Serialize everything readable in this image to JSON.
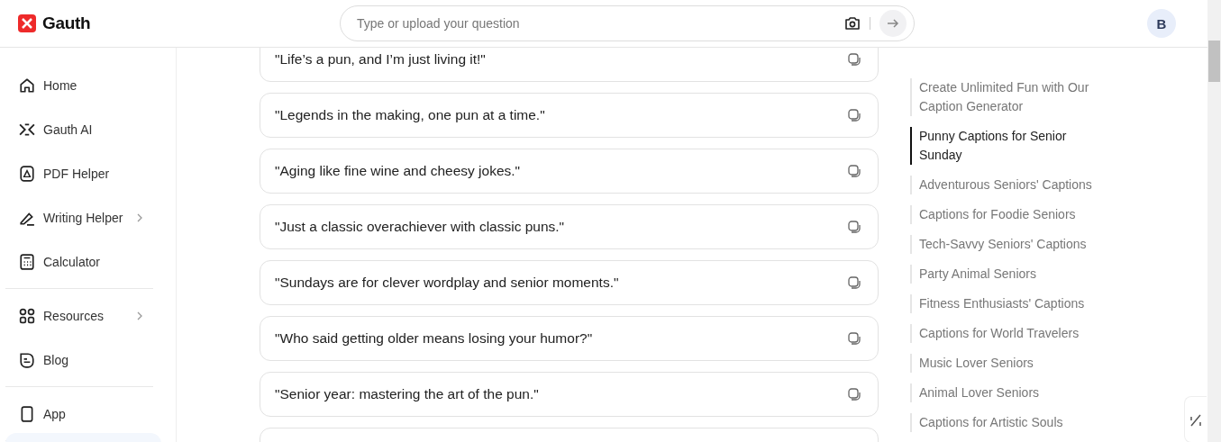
{
  "header": {
    "logo": "Gauth",
    "search": {
      "placeholder": "Type or upload your question"
    },
    "avatar": "B"
  },
  "sidebar": {
    "groups": [
      {
        "items": [
          {
            "label": "Home",
            "expandable": false
          },
          {
            "label": "Gauth AI",
            "expandable": false
          },
          {
            "label": "PDF Helper",
            "expandable": false
          },
          {
            "label": "Writing Helper",
            "expandable": true
          },
          {
            "label": "Calculator",
            "expandable": false
          }
        ]
      },
      {
        "items": [
          {
            "label": "Resources",
            "expandable": true
          },
          {
            "label": "Blog",
            "expandable": false
          }
        ]
      },
      {
        "items": [
          {
            "label": "App",
            "expandable": false
          }
        ]
      }
    ]
  },
  "captions": [
    "\"Life’s a pun, and I’m just living it!\"",
    "\"Legends in the making, one pun at a time.\"",
    "\"Aging like fine wine and cheesy jokes.\"",
    "\"Just a classic overachiever with classic puns.\"",
    "\"Sundays are for clever wordplay and senior moments.\"",
    "\"Who said getting older means losing your humor?\"",
    "\"Senior year: mastering the art of the pun.\""
  ],
  "toc": [
    {
      "label": "Create Unlimited Fun with Our Caption Generator",
      "selected": false
    },
    {
      "label": "Punny Captions for Senior Sunday",
      "selected": true
    },
    {
      "label": "Adventurous Seniors' Captions",
      "selected": false
    },
    {
      "label": "Captions for Foodie Seniors",
      "selected": false
    },
    {
      "label": "Tech-Savvy Seniors' Captions",
      "selected": false
    },
    {
      "label": "Party Animal Seniors",
      "selected": false
    },
    {
      "label": "Fitness Enthusiasts' Captions",
      "selected": false
    },
    {
      "label": "Captions for World Travelers",
      "selected": false
    },
    {
      "label": "Music Lover Seniors",
      "selected": false
    },
    {
      "label": "Animal Lover Seniors",
      "selected": false
    },
    {
      "label": "Captions for Artistic Souls",
      "selected": false
    }
  ]
}
